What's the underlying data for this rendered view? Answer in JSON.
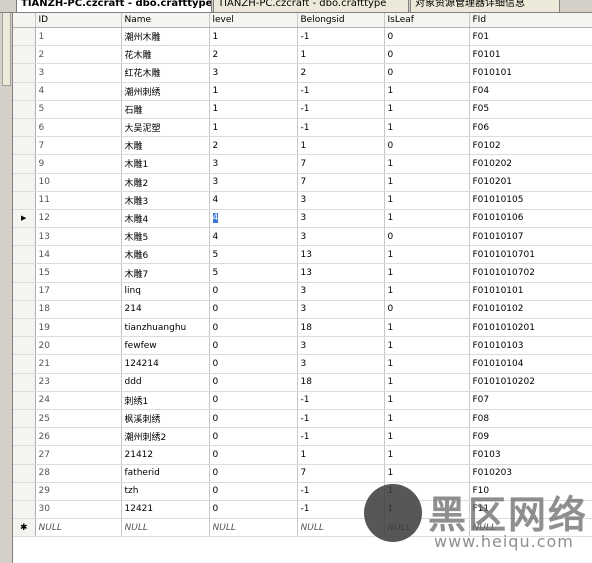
{
  "tabs": [
    {
      "label": "TIANZH-PC.czcraft - dbo.crafttype",
      "active": true
    },
    {
      "label": "TIANZH-PC.czcraft - dbo.crafttype",
      "active": false
    },
    {
      "label": "对象资源管理器详细信息",
      "active": false
    }
  ],
  "grid": {
    "columns": [
      "ID",
      "Name",
      "level",
      "Belongsid",
      "IsLeaf",
      "FId"
    ],
    "current_row_index": 10,
    "rows": [
      [
        "1",
        "潮州木雕",
        "1",
        "-1",
        "0",
        "F01"
      ],
      [
        "2",
        "花木雕",
        "2",
        "1",
        "0",
        "F0101"
      ],
      [
        "3",
        "红花木雕",
        "3",
        "2",
        "0",
        "F010101"
      ],
      [
        "4",
        "潮州刺绣",
        "1",
        "-1",
        "1",
        "F04"
      ],
      [
        "5",
        "石雕",
        "1",
        "-1",
        "1",
        "F05"
      ],
      [
        "6",
        "大吴泥塑",
        "1",
        "-1",
        "1",
        "F06"
      ],
      [
        "7",
        "木雕",
        "2",
        "1",
        "0",
        "F0102"
      ],
      [
        "9",
        "木雕1",
        "3",
        "7",
        "1",
        "F010202"
      ],
      [
        "10",
        "木雕2",
        "3",
        "7",
        "1",
        "F010201"
      ],
      [
        "11",
        "木雕3",
        "4",
        "3",
        "1",
        "F01010105"
      ],
      [
        "12",
        "木雕4",
        "4",
        "3",
        "1",
        "F01010106"
      ],
      [
        "13",
        "木雕5",
        "4",
        "3",
        "0",
        "F01010107"
      ],
      [
        "14",
        "木雕6",
        "5",
        "13",
        "1",
        "F0101010701"
      ],
      [
        "15",
        "木雕7",
        "5",
        "13",
        "1",
        "F0101010702"
      ],
      [
        "17",
        "linq",
        "0",
        "3",
        "1",
        "F01010101"
      ],
      [
        "18",
        "214",
        "0",
        "3",
        "0",
        "F01010102"
      ],
      [
        "19",
        "tianzhuanghu",
        "0",
        "18",
        "1",
        "F0101010201"
      ],
      [
        "20",
        "fewfew",
        "0",
        "3",
        "1",
        "F01010103"
      ],
      [
        "21",
        "124214",
        "0",
        "3",
        "1",
        "F01010104"
      ],
      [
        "23",
        "ddd",
        "0",
        "18",
        "1",
        "F0101010202"
      ],
      [
        "24",
        "刺绣1",
        "0",
        "-1",
        "1",
        "F07"
      ],
      [
        "25",
        "枫溪刺绣",
        "0",
        "-1",
        "1",
        "F08"
      ],
      [
        "26",
        "潮州刺绣2",
        "0",
        "-1",
        "1",
        "F09"
      ],
      [
        "27",
        "21412",
        "0",
        "1",
        "1",
        "F0103"
      ],
      [
        "28",
        "fatherid",
        "0",
        "7",
        "1",
        "F010203"
      ],
      [
        "29",
        "tzh",
        "0",
        "-1",
        "1",
        "F10"
      ],
      [
        "30",
        "12421",
        "0",
        "-1",
        "1",
        "F11"
      ]
    ],
    "new_row": [
      "NULL",
      "NULL",
      "NULL",
      "NULL",
      "NULL",
      "NULL"
    ],
    "current_row_marker": "▶",
    "new_row_marker": "✱"
  },
  "watermark": {
    "text": "黑区网络",
    "url": "www.heiqu.com"
  }
}
